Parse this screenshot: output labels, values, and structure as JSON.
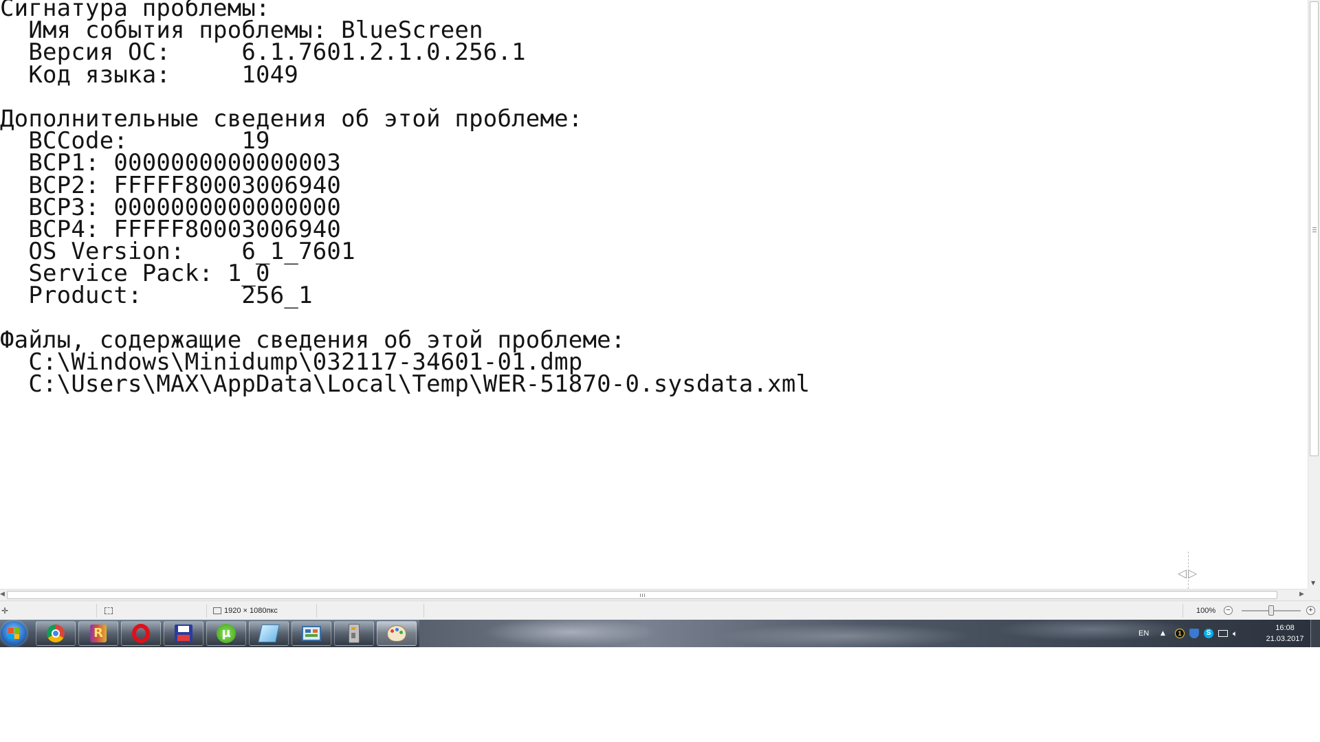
{
  "document": {
    "lines": [
      "Сигнатура проблемы:",
      "  Имя события проблемы: BlueScreen",
      "  Версия ОС:     6.1.7601.2.1.0.256.1",
      "  Код языка:     1049",
      "",
      "Дополнительные сведения об этой проблеме:",
      "  BCCode:        19",
      "  BCP1: 0000000000000003",
      "  BCP2: FFFFF80003006940",
      "  BCP3: 0000000000000000",
      "  BCP4: FFFFF80003006940",
      "  OS Version:    6_1_7601",
      "  Service Pack: 1_0",
      "  Product:       256_1",
      "",
      "Файлы, содержащие сведения об этой проблеме:",
      "  C:\\Windows\\Minidump\\032117-34601-01.dmp",
      "  C:\\Users\\MAX\\AppData\\Local\\Temp\\WER-51870-0.sysdata.xml"
    ]
  },
  "statusbar": {
    "image_size": "1920 × 1080пкс",
    "zoom": "100%",
    "zoom_level": 1.0
  },
  "taskbar": {
    "pinned": [
      "start-orb",
      "chrome-icon",
      "rar-archiver-icon",
      "opera-icon",
      "floppy-save-icon",
      "utorrent-icon",
      "notepad-icon",
      "control-panel-icon",
      "device-icon",
      "paint-icon"
    ],
    "tray": {
      "language": "EN",
      "time": "16:08",
      "date": "21.03.2017"
    }
  },
  "colors": {
    "text": "#141414",
    "statusbar_bg": "#f0f0f0",
    "taskbar_dark": "#333b45",
    "accent_blue": "#2e74c9"
  }
}
